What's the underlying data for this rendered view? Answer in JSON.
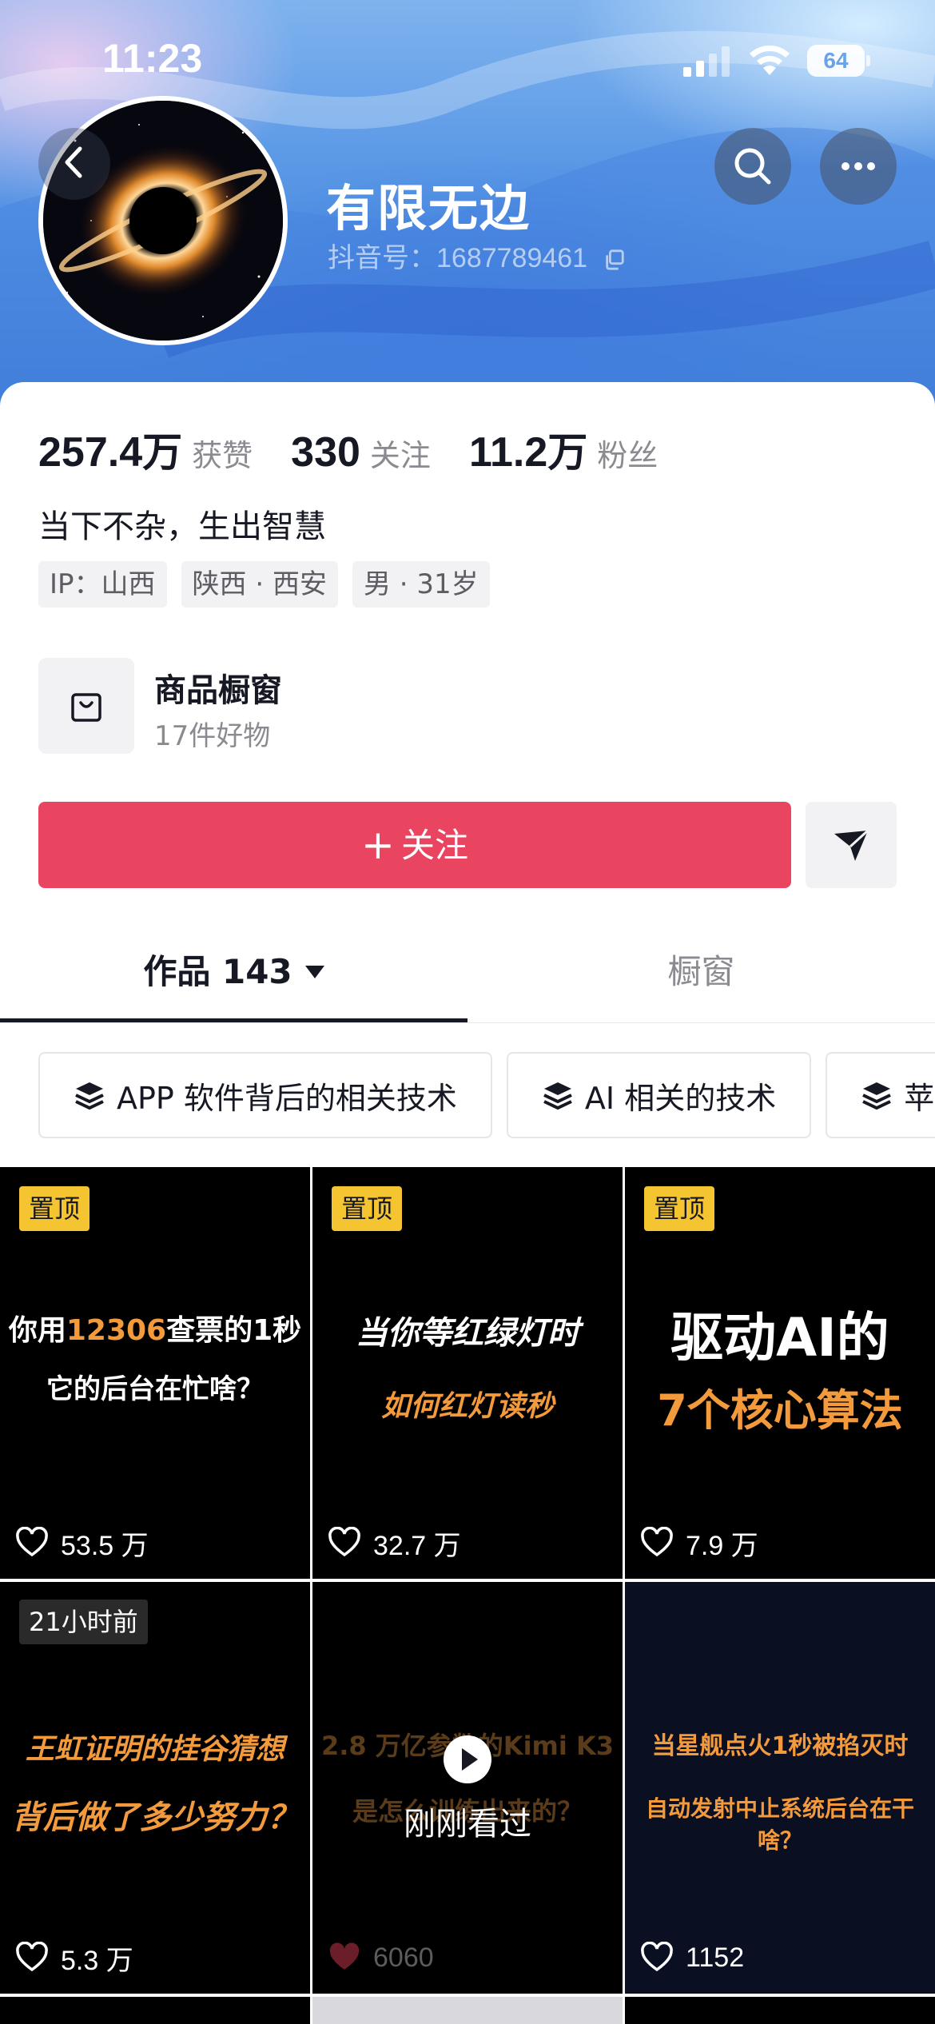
{
  "status_bar": {
    "time": "11:23",
    "battery": "64"
  },
  "profile": {
    "nickname": "有限无边",
    "douyin_id": "抖音号：1687789461",
    "bio": "当下不杂，生出智慧",
    "tags": [
      "IP：山西",
      "陕西 · 西安",
      "男 · 31岁"
    ]
  },
  "stats": [
    {
      "num": "257.4",
      "unit": "万",
      "label": "获赞"
    },
    {
      "num": "330",
      "unit": "",
      "label": "关注"
    },
    {
      "num": "11.2",
      "unit": "万",
      "label": "粉丝"
    }
  ],
  "shop": {
    "title": "商品橱窗",
    "subtitle": "17件好物"
  },
  "actions": {
    "follow_label": "关注",
    "follow_plus": "+"
  },
  "tabs": {
    "works": "作品 143",
    "window": "橱窗"
  },
  "collections": [
    "APP 软件背后的相关技术",
    "AI 相关的技术",
    "苹果"
  ],
  "videos": [
    {
      "badge": "置顶",
      "line1": "你用12306查票的1秒",
      "line1_highlight": "12306",
      "line2": "它的后台在忙啥？",
      "likes": "53.5 万"
    },
    {
      "badge": "置顶",
      "line1": "当你等红绿灯时",
      "line2": "如何红灯读秒",
      "likes": "32.7 万"
    },
    {
      "badge": "置顶",
      "line1": "驱动AI的",
      "line2": "7个核心算法",
      "likes": "7.9 万"
    },
    {
      "badge": "21小时前",
      "line1": "王虹证明的挂谷猜想",
      "line2": "背后做了多少努力？",
      "likes": "5.3 万"
    },
    {
      "badge": "",
      "line1": "2.8 万亿参数的Kimi K3",
      "line2": "是怎么训练出来的？",
      "overlay": "刚刚看过",
      "likes": "6060"
    },
    {
      "badge": "",
      "line1": "当星舰点火1秒被掐灭时",
      "line2": "自动发射中止系统后台在干啥？",
      "likes": "1152"
    }
  ],
  "colors": {
    "accent": "#ea4560",
    "pin": "#f5c531",
    "cover_orange": "#f39a3c"
  }
}
